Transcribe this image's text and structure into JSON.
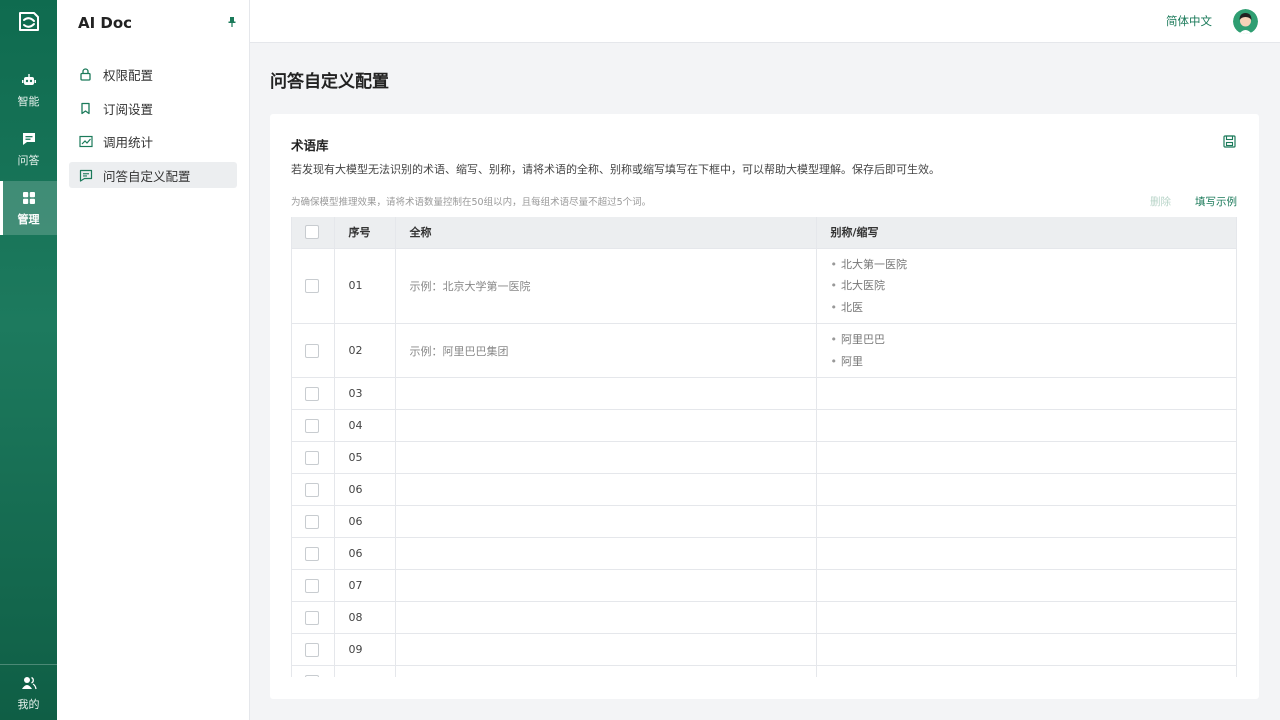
{
  "app": {
    "title": "AI Doc"
  },
  "rail": {
    "items": [
      {
        "label": "智能",
        "icon": "robot-icon"
      },
      {
        "label": "问答",
        "icon": "chat-icon"
      },
      {
        "label": "管理",
        "icon": "grid-icon",
        "active": true
      },
      {
        "label": "我的",
        "icon": "user-group-icon"
      }
    ]
  },
  "sidebar": {
    "items": [
      {
        "label": "权限配置",
        "icon": "lock-icon"
      },
      {
        "label": "订阅设置",
        "icon": "bookmark-icon"
      },
      {
        "label": "调用统计",
        "icon": "chart-icon"
      },
      {
        "label": "问答自定义配置",
        "icon": "message-icon",
        "active": true
      }
    ]
  },
  "header": {
    "language": "简体中文"
  },
  "page": {
    "title": "问答自定义配置"
  },
  "card": {
    "title": "术语库",
    "description": "若发现有大模型无法识别的术语、缩写、别称，请将术语的全称、别称或缩写填写在下框中，可以帮助大模型理解。保存后即可生效。",
    "hint": "为确保模型推理效果，请将术语数量控制在50组以内，且每组术语尽量不超过5个词。",
    "delete_label": "删除",
    "fill_example_label": "填写示例"
  },
  "table": {
    "columns": {
      "index": "序号",
      "full_name": "全称",
      "alias": "别称/缩写"
    },
    "rows": [
      {
        "index": "01",
        "full_name": "示例：北京大学第一医院",
        "aliases": [
          "北大第一医院",
          "北大医院",
          "北医"
        ]
      },
      {
        "index": "02",
        "full_name": "示例：阿里巴巴集团",
        "aliases": [
          "阿里巴巴",
          "阿里"
        ]
      },
      {
        "index": "03",
        "full_name": "",
        "aliases": []
      },
      {
        "index": "04",
        "full_name": "",
        "aliases": []
      },
      {
        "index": "05",
        "full_name": "",
        "aliases": []
      },
      {
        "index": "06",
        "full_name": "",
        "aliases": []
      },
      {
        "index": "06",
        "full_name": "",
        "aliases": []
      },
      {
        "index": "06",
        "full_name": "",
        "aliases": []
      },
      {
        "index": "07",
        "full_name": "",
        "aliases": []
      },
      {
        "index": "08",
        "full_name": "",
        "aliases": []
      },
      {
        "index": "09",
        "full_name": "",
        "aliases": []
      },
      {
        "index": "",
        "full_name": "",
        "aliases": []
      }
    ]
  },
  "colors": {
    "brand": "#1b7a5a",
    "rail_top": "#0f6b4f",
    "rail_bottom": "#0f5e45"
  }
}
